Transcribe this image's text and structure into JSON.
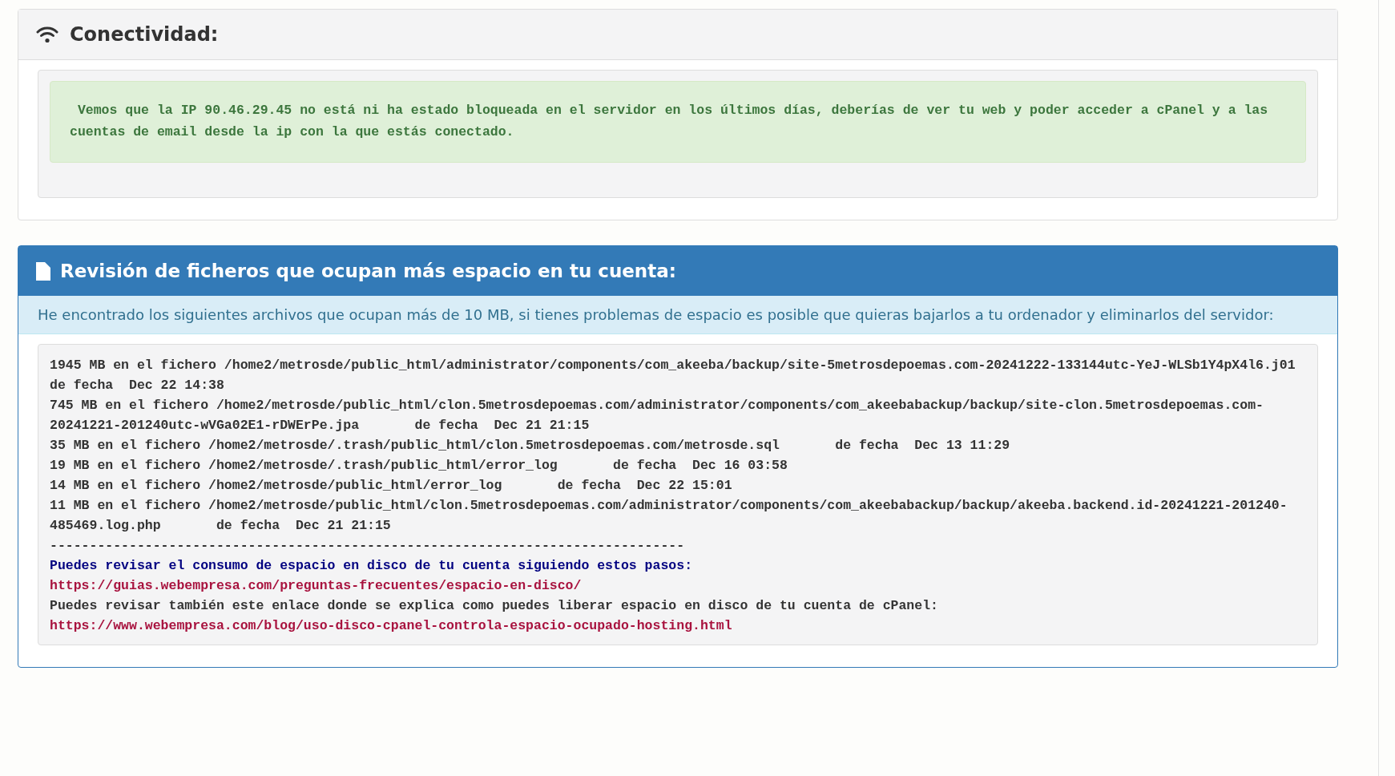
{
  "connectivity_panel": {
    "title": "Conectividad:",
    "message": " Vemos que la IP 90.46.29.45 no está ni ha estado bloqueada en el servidor en los últimos días, deberías de ver tu web y poder acceder a cPanel y a las cuentas de email desde la ip con la que estás conectado."
  },
  "files_panel": {
    "title": "Revisión de ficheros que ocupan más espacio en tu cuenta:",
    "intro": "He encontrado los siguientes archivos que ocupan más de 10 MB, si tienes problemas de espacio es posible que quieras bajarlos a tu ordenador y eliminarlos del servidor:",
    "files": [
      {
        "text": "1945 MB en el fichero /home2/metrosde/public_html/administrator/components/com_akeeba/backup/site-5metrosdepoemas.com-20241222-133144utc-YeJ-WLSb1Y4pX4l6.j01       de fecha  Dec 22 14:38"
      },
      {
        "text": "745 MB en el fichero /home2/metrosde/public_html/clon.5metrosdepoemas.com/administrator/components/com_akeebabackup/backup/site-clon.5metrosdepoemas.com-20241221-201240utc-wVGa02E1-rDWErPe.jpa       de fecha  Dec 21 21:15"
      },
      {
        "text": "35 MB en el fichero /home2/metrosde/.trash/public_html/clon.5metrosdepoemas.com/metrosde.sql       de fecha  Dec 13 11:29"
      },
      {
        "text": "19 MB en el fichero /home2/metrosde/.trash/public_html/error_log       de fecha  Dec 16 03:58"
      },
      {
        "text": "14 MB en el fichero /home2/metrosde/public_html/error_log       de fecha  Dec 22 15:01"
      },
      {
        "text": "11 MB en el fichero /home2/metrosde/public_html/clon.5metrosdepoemas.com/administrator/components/com_akeebabackup/backup/akeeba.backend.id-20241221-201240-485469.log.php       de fecha  Dec 21 21:15"
      }
    ],
    "separator": "--------------------------------------------------------------------------------",
    "tips": [
      {
        "kind": "heading",
        "text": "Puedes revisar el consumo de espacio en disco de tu cuenta siguiendo estos pasos:"
      },
      {
        "kind": "link",
        "text": "https://guias.webempresa.com/preguntas-frecuentes/espacio-en-disco/"
      },
      {
        "kind": "plain",
        "text": "Puedes revisar también este enlace donde se explica como puedes liberar espacio en disco de tu cuenta de cPanel:"
      },
      {
        "kind": "link",
        "text": "https://www.webempresa.com/blog/uso-disco-cpanel-controla-espacio-ocupado-hosting.html"
      }
    ]
  }
}
